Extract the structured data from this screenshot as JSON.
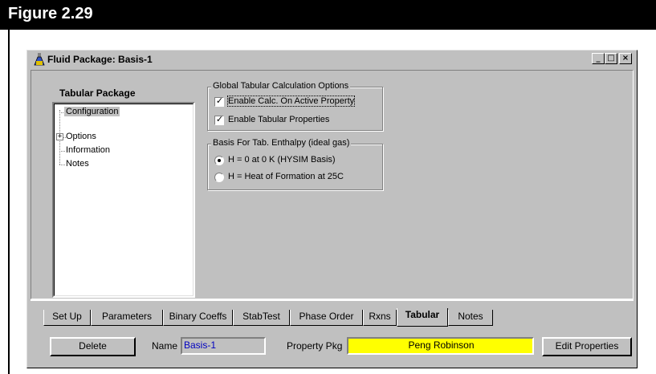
{
  "figure": {
    "title": "Figure 2.29"
  },
  "window": {
    "title": "Fluid Package: Basis-1",
    "controls": {
      "minimize": "_",
      "maximize": "□",
      "close": "×"
    }
  },
  "tree": {
    "heading": "Tabular Package",
    "items": [
      {
        "label": "Configuration",
        "selected": true
      },
      {
        "label": "Options",
        "expandable": true,
        "expander": "+"
      },
      {
        "label": "Information"
      },
      {
        "label": "Notes"
      }
    ]
  },
  "global_options": {
    "title": "Global Tabular Calculation Options",
    "enable_calc": {
      "label": "Enable Calc. On Active Property",
      "checked": true,
      "mark": "✓"
    },
    "enable_tabular": {
      "label": "Enable Tabular Properties",
      "checked": true,
      "mark": "✓"
    }
  },
  "enthalpy_basis": {
    "title": "Basis For Tab. Enthalpy (ideal gas)",
    "options": [
      {
        "label": "H = 0 at 0 K (HYSIM Basis)",
        "selected": true
      },
      {
        "label": "H = Heat of Formation at 25C",
        "selected": false
      }
    ]
  },
  "tabs": [
    {
      "label": "Set Up"
    },
    {
      "label": "Parameters"
    },
    {
      "label": "Binary Coeffs"
    },
    {
      "label": "StabTest"
    },
    {
      "label": "Phase Order"
    },
    {
      "label": "Rxns"
    },
    {
      "label": "Tabular",
      "active": true
    },
    {
      "label": "Notes"
    }
  ],
  "footer": {
    "delete_label": "Delete",
    "name_label": "Name",
    "name_value": "Basis-1",
    "property_pkg_label": "Property Pkg",
    "property_pkg_value": "Peng Robinson",
    "edit_properties_label": "Edit Properties"
  },
  "colors": {
    "window_bg": "#c0c0c0",
    "name_text": "#0000c0",
    "property_pkg_bg": "#ffff00"
  },
  "icons": {
    "app": "flask-icon",
    "tree_expander": "plus-box-icon"
  }
}
